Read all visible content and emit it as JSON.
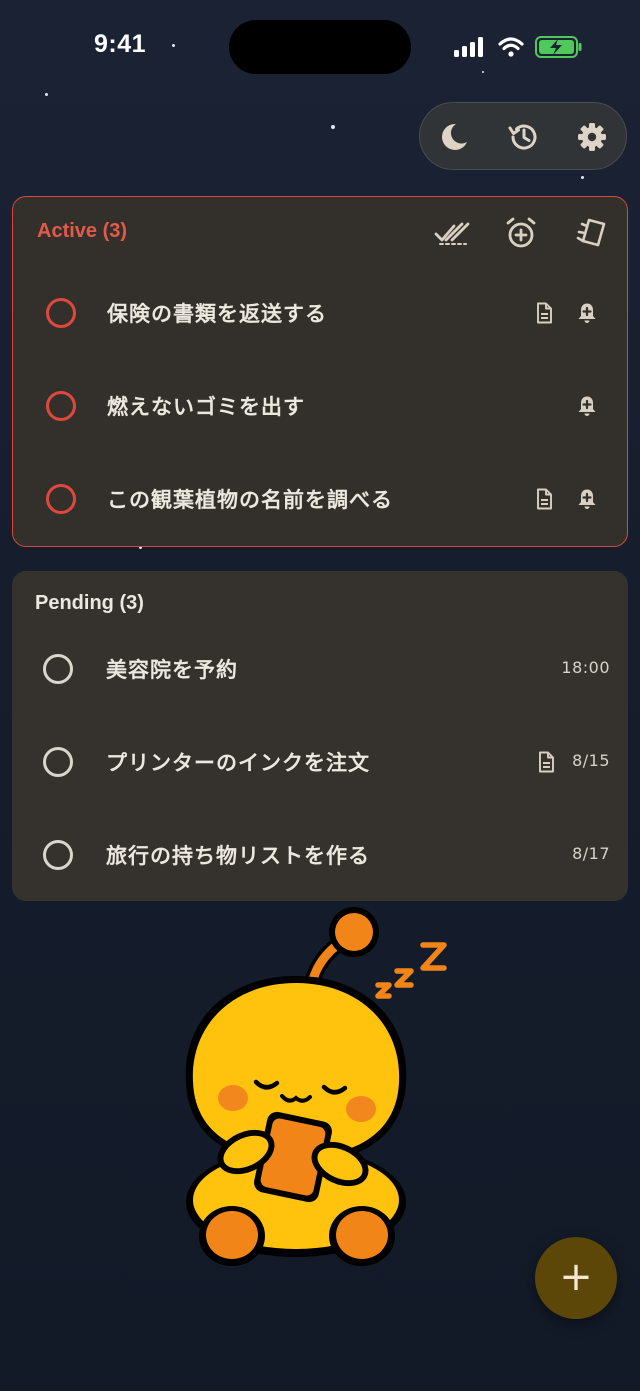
{
  "status_bar": {
    "time": "9:41"
  },
  "toolbar": {
    "icons": [
      "moon-icon",
      "history-icon",
      "gear-icon"
    ]
  },
  "colors": {
    "background": "#172033",
    "card": "#33302c",
    "accent_red": "#e0483e",
    "fab": "#5c4708"
  },
  "active": {
    "title": "Active (3)",
    "header_icons": [
      "check-all-icon",
      "alarm-add-icon",
      "clear-icon"
    ],
    "tasks": [
      {
        "text": "保険の書類を返送する",
        "icons": [
          "note-icon",
          "bell-plus-icon"
        ]
      },
      {
        "text": "燃えないゴミを出す",
        "icons": [
          "bell-plus-icon"
        ]
      },
      {
        "text": "この観葉植物の名前を調べる",
        "icons": [
          "note-icon",
          "bell-plus-icon"
        ]
      }
    ]
  },
  "pending": {
    "title": "Pending (3)",
    "tasks": [
      {
        "text": "美容院を予約",
        "meta": "18:00",
        "icons": []
      },
      {
        "text": "プリンターのインクを注文",
        "meta": "8/15",
        "icons": [
          "note-icon"
        ]
      },
      {
        "text": "旅行の持ち物リストを作る",
        "meta": "8/17",
        "icons": []
      }
    ]
  },
  "fab": {
    "label": "+"
  },
  "mascot": {
    "sleep_text": "zzZ"
  }
}
